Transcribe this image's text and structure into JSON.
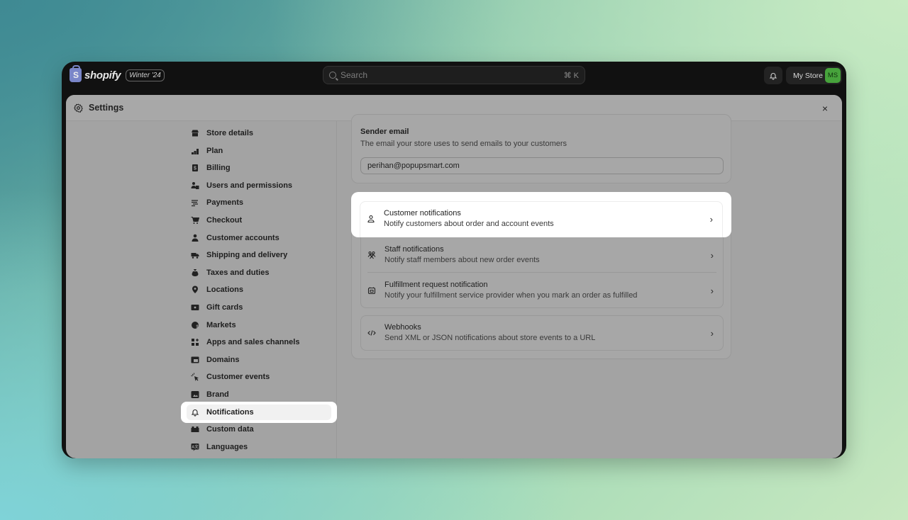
{
  "topbar": {
    "brand": "shopify",
    "edition_badge": "Winter '24",
    "search_placeholder": "Search",
    "search_shortcut": "⌘ K",
    "store_name": "My Store",
    "avatar_initials": "MS",
    "avatar_color": "#47a33c"
  },
  "modal": {
    "title": "Settings",
    "close_label": "×"
  },
  "sidebar": {
    "items": [
      {
        "label": "Store details",
        "icon": "store-icon"
      },
      {
        "label": "Plan",
        "icon": "plan-icon"
      },
      {
        "label": "Billing",
        "icon": "billing-icon"
      },
      {
        "label": "Users and permissions",
        "icon": "users-icon"
      },
      {
        "label": "Payments",
        "icon": "payments-icon"
      },
      {
        "label": "Checkout",
        "icon": "cart-icon"
      },
      {
        "label": "Customer accounts",
        "icon": "person-icon"
      },
      {
        "label": "Shipping and delivery",
        "icon": "truck-icon"
      },
      {
        "label": "Taxes and duties",
        "icon": "tax-bag-icon"
      },
      {
        "label": "Locations",
        "icon": "location-pin-icon"
      },
      {
        "label": "Gift cards",
        "icon": "gift-card-icon"
      },
      {
        "label": "Markets",
        "icon": "globe-icon"
      },
      {
        "label": "Apps and sales channels",
        "icon": "apps-icon"
      },
      {
        "label": "Domains",
        "icon": "domains-icon"
      },
      {
        "label": "Customer events",
        "icon": "cursor-click-icon"
      },
      {
        "label": "Brand",
        "icon": "brand-icon"
      },
      {
        "label": "Notifications",
        "icon": "bell-icon",
        "active": true
      },
      {
        "label": "Custom data",
        "icon": "custom-data-icon"
      },
      {
        "label": "Languages",
        "icon": "languages-icon"
      }
    ]
  },
  "sender_email": {
    "heading": "Sender email",
    "description": "The email your store uses to send emails to your customers",
    "value": "perihan@popupsmart.com"
  },
  "notifications": [
    {
      "title": "Customer notifications",
      "subtitle": "Notify customers about order and account events",
      "icon": "person-outline-icon"
    },
    {
      "title": "Staff notifications",
      "subtitle": "Notify staff members about new order events",
      "icon": "staff-icon"
    },
    {
      "title": "Fulfillment request notification",
      "subtitle": "Notify your fulfillment service provider when you mark an order as fulfilled",
      "icon": "fulfillment-icon"
    }
  ],
  "webhooks": {
    "title": "Webhooks",
    "subtitle": "Send XML or JSON notifications about store events to a URL",
    "icon": "code-icon"
  }
}
